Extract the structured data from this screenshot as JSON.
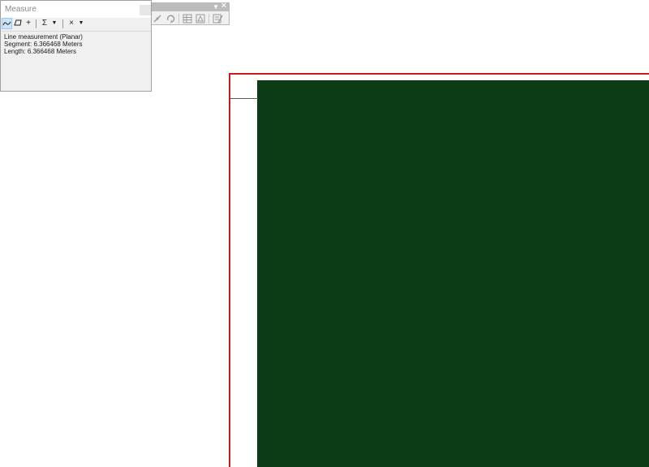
{
  "measure_window": {
    "title": "Measure",
    "toolbar": {
      "measure_line_icon": "measure-line-icon",
      "measure_area_icon": "measure-area-icon",
      "measure_feature_label": "+",
      "sum_label": "Σ",
      "clear_label": "×",
      "dropdown_glyph": "▼"
    },
    "results": {
      "mode": "Line measurement (Planar)",
      "segment": "Segment: 6.366468 Meters",
      "length": "Length: 6.366468 Meters"
    }
  },
  "background_toolbar": {
    "dropdown_glyph": "▼",
    "close_glyph": "✕"
  },
  "map": {
    "frame_color": "#cc1a1a",
    "feature_color": "#0b3c16"
  }
}
